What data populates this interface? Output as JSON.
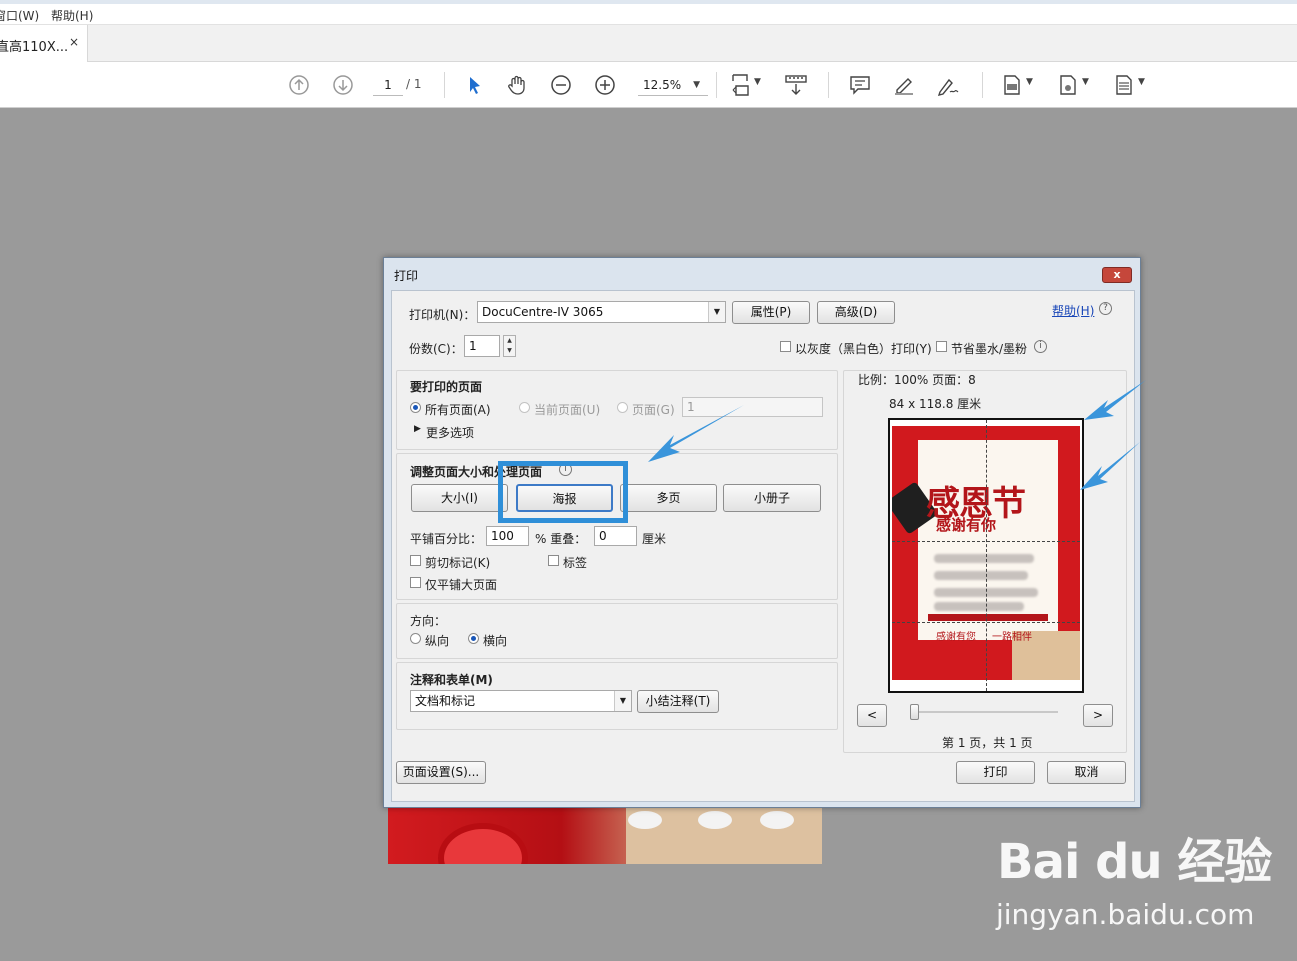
{
  "menu": {
    "window": "窗口(W)",
    "help": "帮助(H)"
  },
  "doc_tab": {
    "title": "直高110X...",
    "close": "×"
  },
  "toolbar": {
    "page_current": "1",
    "page_total": "/ 1",
    "zoom": "12.5%",
    "icons": [
      "prev-page-icon",
      "next-page-icon",
      "select-arrow-icon",
      "hand-icon",
      "zoom-out-icon",
      "zoom-in-icon",
      "fit-page-icon",
      "scroll-mode-icon",
      "comment-icon",
      "highlight-pen-icon",
      "sign-icon",
      "page-view-icon",
      "export-page-icon",
      "page-options-icon"
    ]
  },
  "dialog": {
    "title": "打印",
    "close": "x",
    "printer_label": "打印机(N)：",
    "printer_value": "DocuCentre-IV 3065",
    "properties_btn": "属性(P)",
    "advanced_btn": "高级(D)",
    "help_link": "帮助(H)",
    "copies_label": "份数(C)：",
    "copies_value": "1",
    "grayscale_label": "以灰度（黑白色）打印(Y)",
    "save_ink_label": "节省墨水/墨粉",
    "pages_section": {
      "heading": "要打印的页面",
      "all_pages": "所有页面(A)",
      "current_page": "当前页面(U)",
      "pages": "页面(G)",
      "pages_value": "1",
      "more_options": "更多选项"
    },
    "sizing_section": {
      "heading": "调整页面大小和处理页面",
      "size_btn": "大小(I)",
      "poster_btn": "海报",
      "multiple_btn": "多页",
      "booklet_btn": "小册子",
      "tile_scale_label": "平铺百分比：",
      "tile_scale_value": "100",
      "overlap_label": "% 重叠：",
      "overlap_value": "0",
      "overlap_unit": "厘米",
      "cut_marks": "剪切标记(K)",
      "labels": "标签",
      "tile_large_only": "仅平铺大页面"
    },
    "orientation_section": {
      "heading": "方向：",
      "portrait": "纵向",
      "landscape": "横向"
    },
    "comments_section": {
      "heading": "注释和表单(M)",
      "value": "文档和标记",
      "summarize_btn": "小结注释(T)"
    },
    "preview": {
      "scale_text": "比例：100% 页面：8",
      "size_text": "84 x 118.8 厘米",
      "prev_btn": "<",
      "next_btn": ">",
      "page_info": "第 1 页，共 1 页",
      "poster_title": "感恩节",
      "poster_sub": "感谢有你",
      "poster_foot_left": "感谢有您",
      "poster_foot_right": "一路相伴"
    },
    "page_setup_btn": "页面设置(S)...",
    "print_btn": "打印",
    "cancel_btn": "取消"
  },
  "watermark": {
    "logo": "Bai du 经验",
    "url": "jingyan.baidu.com"
  },
  "colors": {
    "highlight_box": "#2f8fd8",
    "arrow": "#3a95db",
    "dialog_frame": "#dbe4ee",
    "poster_red": "#d1191e"
  }
}
